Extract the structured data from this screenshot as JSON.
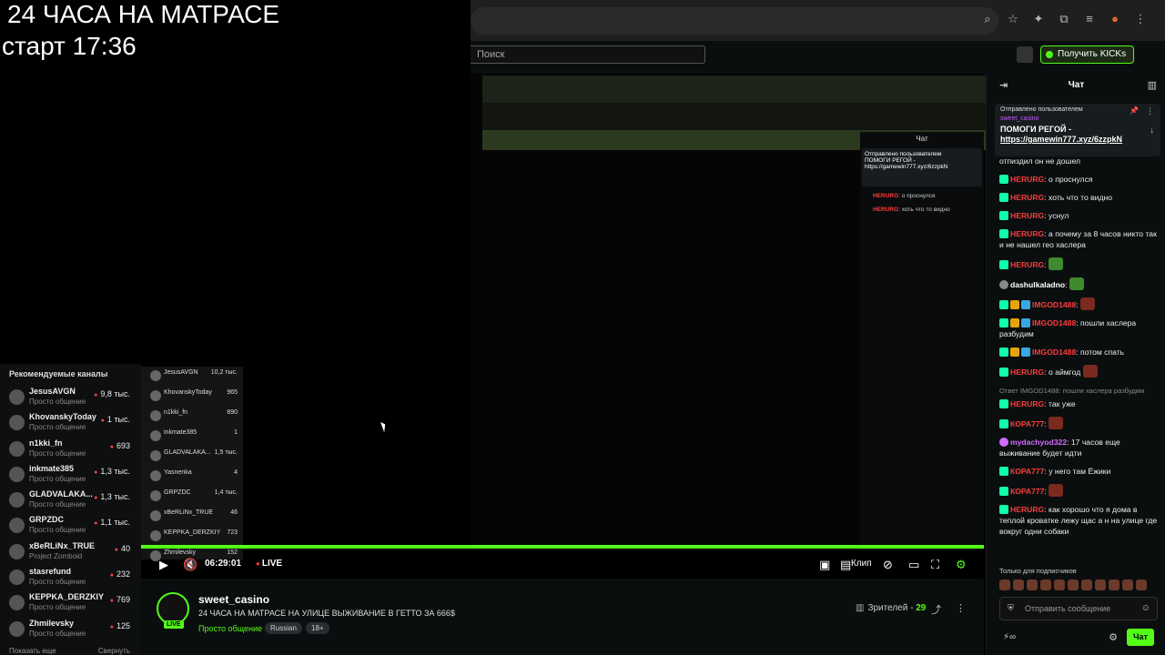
{
  "overlay": {
    "line1": "24 ЧАСА НА МАТРАСЕ",
    "line2": "старт 17:36"
  },
  "header": {
    "search_placeholder": "Поиск",
    "get_kicks": "Получить KICKs"
  },
  "recommended": {
    "title": "Рекомендуемые каналы",
    "items": [
      {
        "name": "JesusAVGN",
        "category": "Просто общение",
        "viewers": "9,8 тыс."
      },
      {
        "name": "KhovanskyToday",
        "category": "Просто общение",
        "viewers": "1 тыс."
      },
      {
        "name": "n1kki_fn",
        "category": "Просто общение",
        "viewers": "693"
      },
      {
        "name": "inkmate385",
        "category": "Просто общение",
        "viewers": "1,3 тыс."
      },
      {
        "name": "GLADVALAKA...",
        "category": "Просто общение",
        "viewers": "1,3 тыс."
      },
      {
        "name": "GRPZDC",
        "category": "Просто общение",
        "viewers": "1,1 тыс."
      },
      {
        "name": "xBeRLiNx_TRUE",
        "category": "Project Zomboid",
        "viewers": "40"
      },
      {
        "name": "stasrefund",
        "category": "Просто общение",
        "viewers": "232"
      },
      {
        "name": "KEPPKA_DERZKIY",
        "category": "Просто общение",
        "viewers": "769"
      },
      {
        "name": "Zhmilevsky",
        "category": "Просто общение",
        "viewers": "125"
      }
    ],
    "show_more": "Показать еще",
    "collapse": "Свернуть"
  },
  "recommended_nested": [
    {
      "name": "JesusAVGN",
      "viewers": "10,2 тыс."
    },
    {
      "name": "KhovanskyToday",
      "viewers": "965"
    },
    {
      "name": "n1kki_fn",
      "viewers": "890"
    },
    {
      "name": "inkmate385",
      "viewers": "1"
    },
    {
      "name": "GLADVALAKA...",
      "viewers": "1,5 тыс."
    },
    {
      "name": "Yasnenka",
      "viewers": "4"
    },
    {
      "name": "GRPZDC",
      "viewers": "1,4 тыс."
    },
    {
      "name": "xBeRLiNx_TRUE",
      "viewers": "46"
    },
    {
      "name": "KEPPKA_DERZKIY",
      "viewers": "723"
    },
    {
      "name": "Zhmilevsky",
      "viewers": "152"
    }
  ],
  "player": {
    "time": "06:29:01",
    "live": "LIVE",
    "clip": "Клип",
    "progress": 1.0
  },
  "stream": {
    "channel": "sweet_casino",
    "title": "24 ЧАСА НА МАТРАСЕ НА УЛИЦЕ ВЫЖИВАНИЕ В ГЕТТО ЗА 666$",
    "category": "Просто общение",
    "tags": [
      "Russian",
      "18+"
    ],
    "viewers_label": "Зрителей - ",
    "viewers": "29",
    "live": "LIVE"
  },
  "chat": {
    "title": "Чат",
    "pinned": {
      "header": "Отправлено пользователем",
      "user": "sweet_casino",
      "message": "ПОМОГИ РЕГОЙ -",
      "link": "https://gamewin777.xyz/6zzpkN"
    },
    "messages": [
      {
        "user": "",
        "text": "отпиздил он не дошел",
        "color": "white"
      },
      {
        "user": "HERURG",
        "text": ": о проснулся",
        "color": "red"
      },
      {
        "user": "HERURG",
        "text": ": хоть что то видно",
        "color": "red"
      },
      {
        "user": "HERURG",
        "text": ": уснул",
        "color": "red"
      },
      {
        "user": "HERURG",
        "text": ": а почему за 8 часов никто так и не нашел гео хаслера",
        "color": "red"
      },
      {
        "user": "HERURG",
        "text": ":",
        "color": "red"
      },
      {
        "user": "dashulkaladno",
        "text": ":",
        "color": "white"
      },
      {
        "user": "IMGOD1488",
        "text": ":",
        "color": "red"
      },
      {
        "user": "IMGOD1488",
        "text": ": пошли хаслера разбудим",
        "color": "red"
      },
      {
        "user": "IMGOD1488",
        "text": ": потом спать",
        "color": "red"
      },
      {
        "user": "HERURG",
        "text": ": о аймгод",
        "color": "red"
      },
      {
        "user": "",
        "reply": "Ответ IMGOD1488: пошли хаслера разбудим",
        "text": "",
        "color": "white"
      },
      {
        "user": "HERURG",
        "text": ": так уже",
        "color": "red"
      },
      {
        "user": "КОРА777",
        "text": ":",
        "color": "red"
      },
      {
        "user": "mydachyod322",
        "text": ": 17 часов еще выживание будет идти",
        "color": "violet"
      },
      {
        "user": "КОРА777",
        "text": ": у него там Ёжики",
        "color": "red"
      },
      {
        "user": "КОРА777",
        "text": ":",
        "color": "red"
      },
      {
        "user": "HERURG",
        "text": ": как хорошо что я дома в теплой кроватке лежу щас а н на улице где вокруг одни собаки",
        "color": "red"
      }
    ],
    "subs_only": "Только для подписчиков",
    "send_placeholder": "Отправить сообщение",
    "infinity": "∞",
    "send_button": "Чат"
  }
}
